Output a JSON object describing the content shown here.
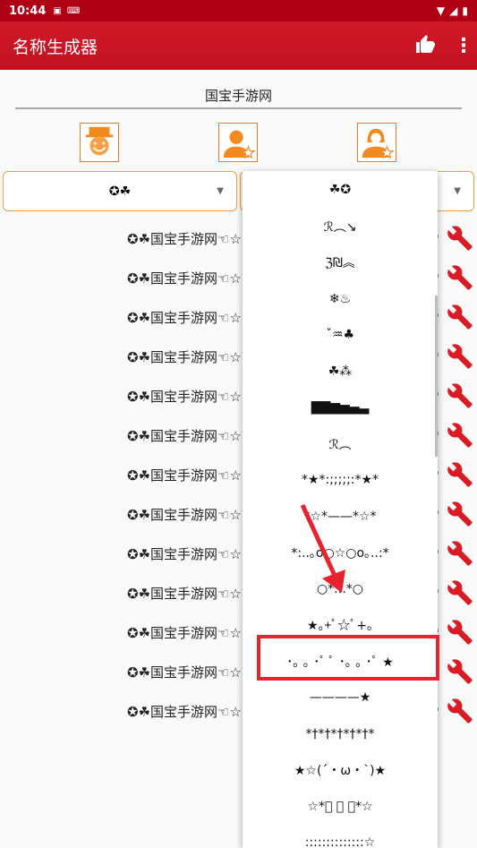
{
  "status_bar": {
    "time": "10:44"
  },
  "app_bar": {
    "title": "名称生成器"
  },
  "name_input": {
    "value": "国宝手游网"
  },
  "spinners": [
    {
      "value": "✪☘"
    }
  ],
  "result_rows": [
    "✪☘国宝手游网☜☆",
    "✪☘国宝手游网☜☆",
    "✪☘国宝手游网☜☆",
    "✪☘国宝手游网☜☆",
    "✪☘国宝手游网☜☆",
    "✪☘国宝手游网☜☆",
    "✪☘国宝手游网☜☆",
    "✪☘国宝手游网☜☆",
    "✪☘国宝手游网☜☆",
    "✪☘国宝手游网☜☆",
    "✪☘国宝手游网☜☆",
    "✪☘国宝手游网☜☆",
    "✪☘国宝手游网☜☆"
  ],
  "dropdown_options": [
    "☘✪",
    "ℛ︵↘",
    "ℨ₪︽",
    "❄♨",
    "ˇ♒♣",
    "☘⁂",
    "▇▇▆▅▄▃",
    "ℛ︵",
    "*★*:;;;;;:*★*",
    "*☆*——*☆*",
    "*:..｡o○☆○o｡..:*",
    "○*.:.*○",
    "★｡+ﾟ☆ﾟ+｡",
    "･｡ ｡ ･ﾟ ﾟ ･｡ ｡ ･ﾟ ★",
    "————★",
    "*†*†*†*†*†*",
    "★☆(´・ω・`)★",
    "☆*ﾟ ﾟ ﾟ*☆",
    "::::::::::::::☆"
  ],
  "colors": {
    "app_bar": "#c2101f",
    "accent": "#e07b2a",
    "highlight": "#e8222e",
    "wrench": "#d81b24"
  },
  "icons": [
    "thumbs-up-icon",
    "more-vert-icon",
    "wrench-icon",
    "avatar-clown-icon",
    "avatar-male-star-icon",
    "avatar-female-star-icon"
  ]
}
